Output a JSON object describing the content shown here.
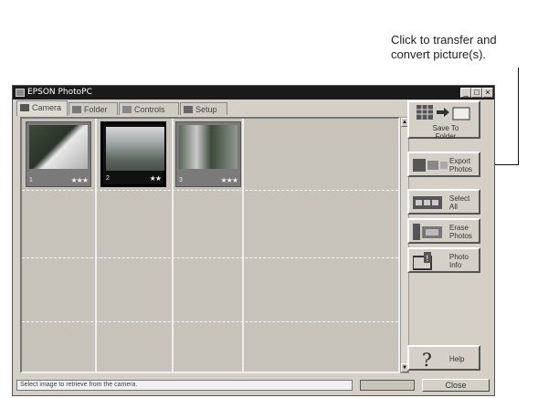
{
  "callout": {
    "line1": "Click to transfer and",
    "line2": "convert picture(s)."
  },
  "window": {
    "title": "EPSON PhotoPC",
    "controls": [
      "_",
      "□",
      "×"
    ]
  },
  "tabs": [
    {
      "label": "Camera",
      "icon": "camera-icon",
      "active": true
    },
    {
      "label": "Folder",
      "icon": "folder-icon",
      "active": false
    },
    {
      "label": "Controls",
      "icon": "controls-icon",
      "active": false
    },
    {
      "label": "Setup",
      "icon": "setup-icon",
      "active": false
    }
  ],
  "thumbnails": [
    {
      "index": "1",
      "stars": "★★★",
      "selected": false,
      "image": "flower-photo"
    },
    {
      "index": "2",
      "stars": "★★",
      "selected": true,
      "image": "landscape-photo"
    },
    {
      "index": "3",
      "stars": "★★★",
      "selected": false,
      "image": "garden-photo"
    }
  ],
  "sidebar": {
    "save_to_folder": "Save To Folder",
    "export_photos": "Export Photos",
    "select_all": "Select All",
    "erase_photos": "Erase Photos",
    "photo_info": "Photo Info",
    "help": "Help"
  },
  "status": {
    "text": "Select image to retrieve from the camera.",
    "close_label": "Close"
  },
  "colors": {
    "window_bg": "#d4d0c8",
    "titlebar": "#1a1a1a",
    "grid_bg": "#c7c3bb"
  }
}
